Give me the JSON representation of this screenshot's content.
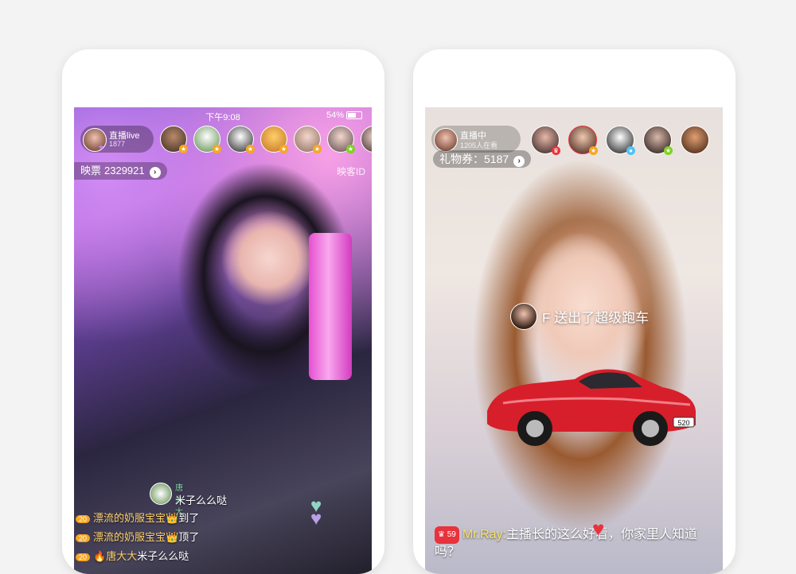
{
  "left_phone": {
    "status": {
      "time": "下午9:08",
      "battery": "54%"
    },
    "host": {
      "name": "直播live",
      "count": "1877"
    },
    "ticket": {
      "label": "映票",
      "value": "2329921"
    },
    "watermark": "映客ID",
    "sticky_user": {
      "name": "唐大大",
      "text": "米子么么哒"
    },
    "chat": [
      {
        "level": "20",
        "user": "漂流的奶服宝宝",
        "text": "到了"
      },
      {
        "level": "20",
        "user": "漂流的奶服宝宝",
        "text": "顶了"
      },
      {
        "level": "20",
        "user": "唐大大",
        "text": "米子么么哒"
      }
    ]
  },
  "right_phone": {
    "host": {
      "name": "直播中",
      "count": "1205人在看"
    },
    "ticket": {
      "label": "礼物券：",
      "value": "5187"
    },
    "gift_message": "F 送出了超级跑车",
    "car_plate": "520",
    "chat": [
      {
        "level": "59",
        "user": "Mr.Ray:",
        "text": "主播长的这么好看，你家里人知道吗？"
      }
    ]
  },
  "colors": {
    "badge_gold": "#f6a623",
    "heart": "#e8323c",
    "accent": "#c084fc"
  }
}
